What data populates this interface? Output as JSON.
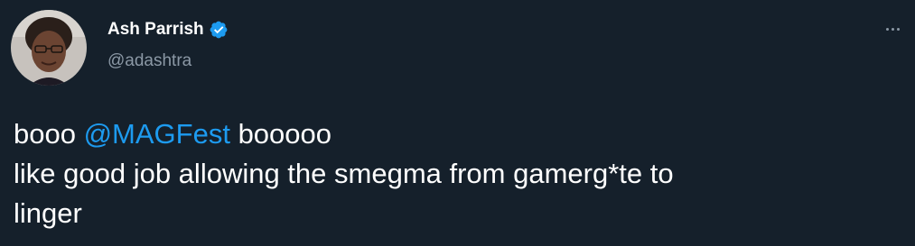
{
  "author": {
    "display_name": "Ash Parrish",
    "handle": "@adashtra",
    "verified_icon": "verified-badge-icon",
    "avatar_icon": "profile-photo"
  },
  "more_icon": "more-options-icon",
  "tweet": {
    "line1_before": "booo ",
    "line1_mention": "@MAGFest",
    "line1_after": " booooo",
    "line2": "like good job allowing the smegma from gamerg*te to",
    "line3": "linger"
  },
  "colors": {
    "background": "#15202b",
    "text": "#ffffff",
    "secondary_text": "#8b98a5",
    "accent": "#1d9bf0"
  }
}
